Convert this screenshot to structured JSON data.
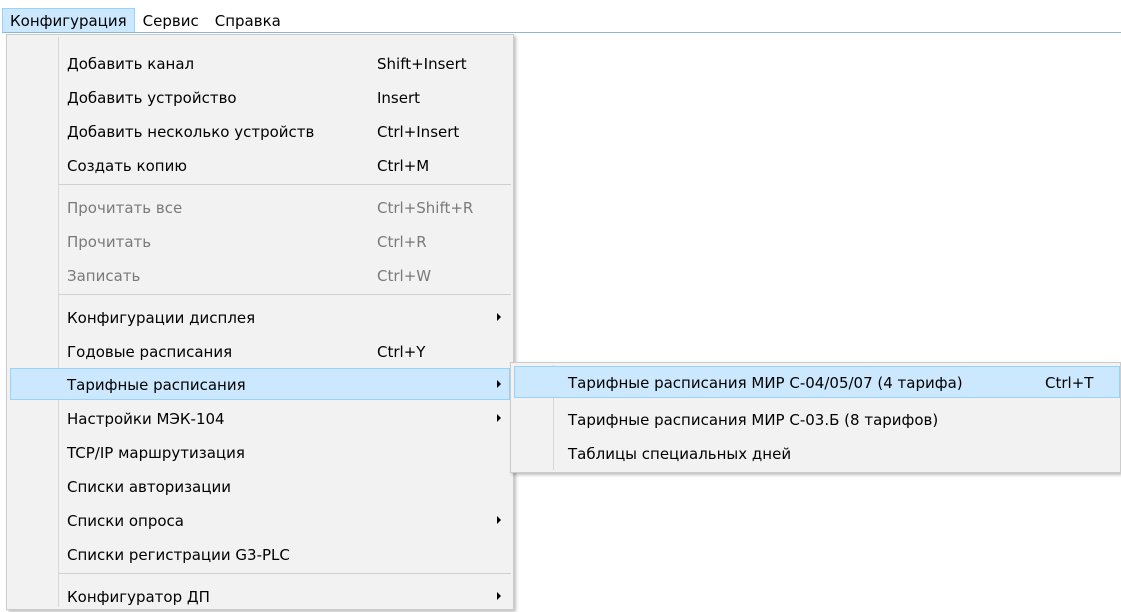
{
  "menubar": {
    "items": [
      "Конфигурация",
      "Сервис",
      "Справка"
    ]
  },
  "main_menu": {
    "items": [
      {
        "label": "Добавить канал",
        "shortcut": "Shift+Insert"
      },
      {
        "label": "Добавить устройство",
        "shortcut": "Insert"
      },
      {
        "label": "Добавить несколько устройств",
        "shortcut": "Ctrl+Insert"
      },
      {
        "label": "Создать копию",
        "shortcut": "Ctrl+M"
      },
      {
        "label": "Прочитать все",
        "shortcut": "Ctrl+Shift+R"
      },
      {
        "label": "Прочитать",
        "shortcut": "Ctrl+R"
      },
      {
        "label": "Записать",
        "shortcut": "Ctrl+W"
      },
      {
        "label": "Конфигурации дисплея",
        "shortcut": ""
      },
      {
        "label": "Годовые расписания",
        "shortcut": "Ctrl+Y"
      },
      {
        "label": "Тарифные расписания",
        "shortcut": ""
      },
      {
        "label": "Настройки МЭК-104",
        "shortcut": ""
      },
      {
        "label": "TCP/IP маршрутизация",
        "shortcut": ""
      },
      {
        "label": "Списки авторизации",
        "shortcut": ""
      },
      {
        "label": "Списки опроса",
        "shortcut": ""
      },
      {
        "label": "Списки регистрации G3-PLC",
        "shortcut": ""
      },
      {
        "label": "Конфигуратор ДП",
        "shortcut": ""
      }
    ]
  },
  "submenu": {
    "items": [
      {
        "label": "Тарифные расписания МИР С-04/05/07 (4 тарифа)",
        "shortcut": "Ctrl+T"
      },
      {
        "label": "Тарифные расписания МИР С-03.Б (8 тарифов)",
        "shortcut": ""
      },
      {
        "label": "Таблицы специальных дней",
        "shortcut": ""
      }
    ]
  }
}
